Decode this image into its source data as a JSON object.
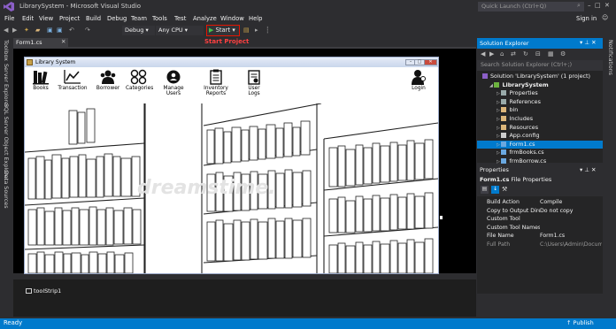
{
  "window": {
    "title": "LibrarySystem - Microsoft Visual Studio",
    "quick_launch_placeholder": "Quick Launch (Ctrl+Q)",
    "sign_in": "Sign in"
  },
  "menu": [
    "File",
    "Edit",
    "View",
    "Project",
    "Build",
    "Debug",
    "Team",
    "Tools",
    "Test",
    "Analyze",
    "Window",
    "Help"
  ],
  "toolbar": {
    "config": "Debug",
    "platform": "Any CPU",
    "start_label": "Start",
    "annotation": "Start Project"
  },
  "left_tabs": [
    "Toolbox",
    "Server Explorer",
    "SQL Server Object Explorer",
    "Data Sources"
  ],
  "right_tabs": [
    "Notifications"
  ],
  "document_tab": "Form1.cs [Design]",
  "form": {
    "title": "Library System",
    "buttons": [
      "Books",
      "Transaction",
      "Borrower",
      "Categories",
      "Manage Users",
      "Inventory Reports",
      "User Logs"
    ],
    "login_label": "Login",
    "watermark": "dreamstime."
  },
  "tray": {
    "item": "toolStrip1"
  },
  "solution_explorer": {
    "title": "Solution Explorer",
    "search_placeholder": "Search Solution Explorer (Ctrl+;)",
    "items": [
      {
        "label": "Solution 'LibrarySystem' (1 project)",
        "indent": 0,
        "icon": "solution-icon",
        "bold": false,
        "selected": false
      },
      {
        "label": "LibrarySystem",
        "indent": 1,
        "icon": "project-icon",
        "bold": true,
        "selected": false
      },
      {
        "label": "Properties",
        "indent": 2,
        "icon": "wrench-icon",
        "bold": false,
        "selected": false
      },
      {
        "label": "References",
        "indent": 2,
        "icon": "references-icon",
        "bold": false,
        "selected": false
      },
      {
        "label": "bin",
        "indent": 2,
        "icon": "folder-icon",
        "bold": false,
        "selected": false
      },
      {
        "label": "Includes",
        "indent": 2,
        "icon": "folder-icon",
        "bold": false,
        "selected": false
      },
      {
        "label": "Resources",
        "indent": 2,
        "icon": "folder-icon",
        "bold": false,
        "selected": false
      },
      {
        "label": "App.config",
        "indent": 2,
        "icon": "config-icon",
        "bold": false,
        "selected": false
      },
      {
        "label": "Form1.cs",
        "indent": 2,
        "icon": "form-icon",
        "bold": false,
        "selected": true
      },
      {
        "label": "frmBooks.cs",
        "indent": 2,
        "icon": "form-icon",
        "bold": false,
        "selected": false
      },
      {
        "label": "frmBorrow.cs",
        "indent": 2,
        "icon": "form-icon",
        "bold": false,
        "selected": false
      }
    ]
  },
  "properties": {
    "title": "Properties",
    "object": "Form1.cs",
    "object_type": "File Properties",
    "rows": [
      {
        "name": "Build Action",
        "value": "Compile",
        "dim": false
      },
      {
        "name": "Copy to Output Directory",
        "value": "Do not copy",
        "dim": false
      },
      {
        "name": "Custom Tool",
        "value": "",
        "dim": false
      },
      {
        "name": "Custom Tool Namespace",
        "value": "",
        "dim": false
      },
      {
        "name": "File Name",
        "value": "Form1.cs",
        "dim": false
      },
      {
        "name": "Full Path",
        "value": "C:\\Users\\Admin\\Documents",
        "dim": true
      }
    ]
  },
  "status": {
    "text": "Ready",
    "publish": "Publish"
  },
  "colors": {
    "accent": "#007acc",
    "annotation": "#e51400",
    "background": "#2d2d30"
  }
}
